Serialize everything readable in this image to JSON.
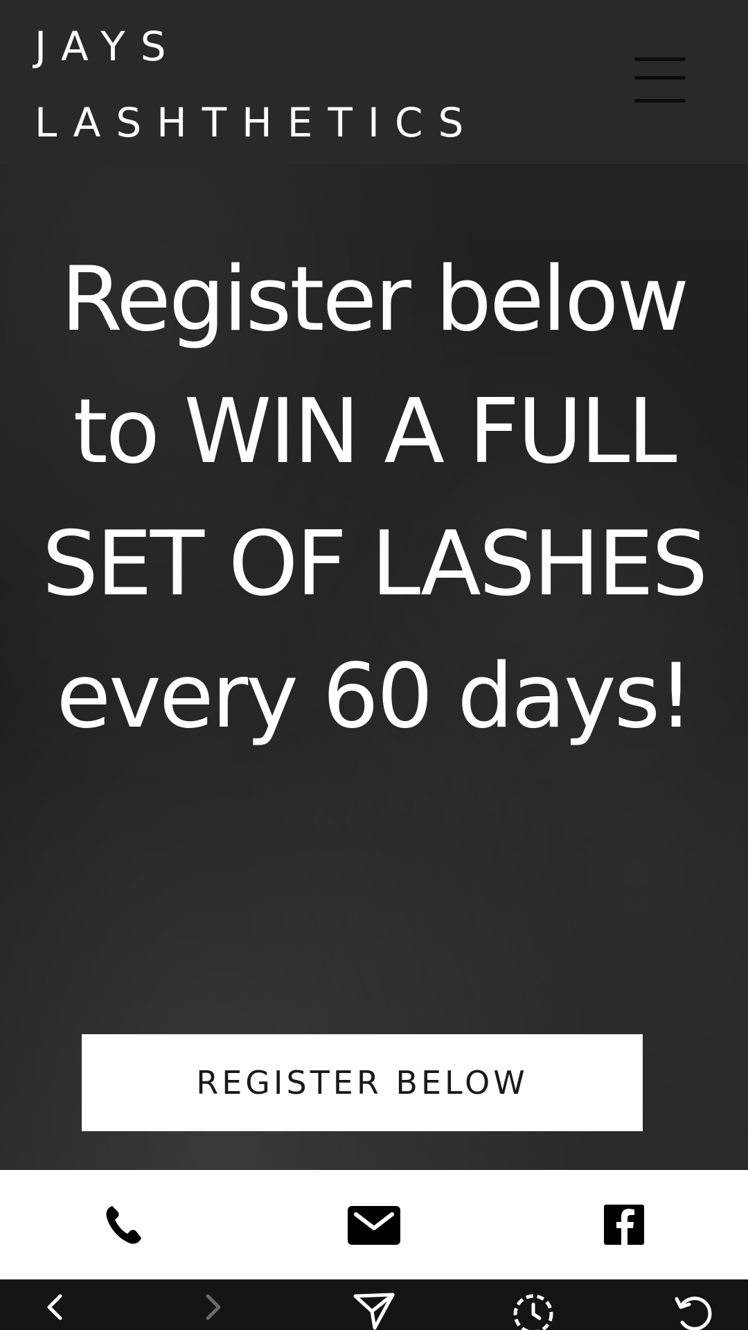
{
  "header": {
    "brand_line_1": "JAYS",
    "brand_line_2": "LASHTHETICS",
    "menu_icon": "hamburger-menu-icon"
  },
  "hero": {
    "title": "Register below to WIN A FULL SET OF LASHES every 60 days!",
    "cta_label": "REGISTER BELOW"
  },
  "contact_bar": {
    "icons": [
      "phone-icon",
      "mail-icon",
      "facebook-icon"
    ]
  },
  "browser_bar": {
    "icons": [
      "back-icon",
      "forward-icon",
      "share-icon",
      "history-icon",
      "reload-icon"
    ]
  },
  "colors": {
    "header_bg": "#2a282b",
    "hero_bg": "#1f1f1f",
    "text": "#ffffff",
    "button_bg": "#ffffff",
    "browser_bar_bg": "#141414"
  }
}
